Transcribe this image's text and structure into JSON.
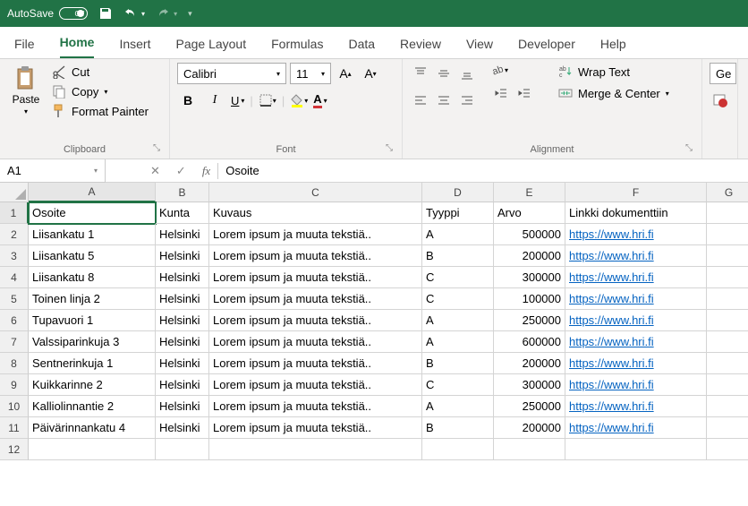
{
  "titlebar": {
    "autosave_label": "AutoSave",
    "autosave_state": "Off"
  },
  "tabs": [
    "File",
    "Home",
    "Insert",
    "Page Layout",
    "Formulas",
    "Data",
    "Review",
    "View",
    "Developer",
    "Help"
  ],
  "active_tab": "Home",
  "clipboard": {
    "paste": "Paste",
    "cut": "Cut",
    "copy": "Copy",
    "format_painter": "Format Painter",
    "label": "Clipboard"
  },
  "font": {
    "name": "Calibri",
    "size": "11",
    "label": "Font"
  },
  "alignment": {
    "wrap": "Wrap Text",
    "merge": "Merge & Center",
    "label": "Alignment"
  },
  "number": {
    "general": "Ge",
    "label": ""
  },
  "namebox": "A1",
  "formula": "Osoite",
  "cols": [
    "A",
    "B",
    "C",
    "D",
    "E",
    "F",
    "G"
  ],
  "headers": [
    "Osoite",
    "Kunta",
    "Kuvaus",
    "Tyyppi",
    "Arvo",
    "Linkki dokumenttiin",
    ""
  ],
  "rows": [
    {
      "a": "Liisankatu 1",
      "b": "Helsinki",
      "c": "Lorem ipsum ja muuta tekstiä..",
      "d": "A",
      "e": "500000",
      "f": "https://www.hri.fi"
    },
    {
      "a": "Liisankatu 5",
      "b": "Helsinki",
      "c": "Lorem ipsum ja muuta tekstiä..",
      "d": "B",
      "e": "200000",
      "f": "https://www.hri.fi"
    },
    {
      "a": "Liisankatu 8",
      "b": "Helsinki",
      "c": "Lorem ipsum ja muuta tekstiä..",
      "d": "C",
      "e": "300000",
      "f": "https://www.hri.fi"
    },
    {
      "a": "Toinen linja 2",
      "b": "Helsinki",
      "c": "Lorem ipsum ja muuta tekstiä..",
      "d": "C",
      "e": "100000",
      "f": "https://www.hri.fi"
    },
    {
      "a": "Tupavuori 1",
      "b": "Helsinki",
      "c": "Lorem ipsum ja muuta tekstiä..",
      "d": "A",
      "e": "250000",
      "f": "https://www.hri.fi"
    },
    {
      "a": "Valssiparinkuja 3",
      "b": "Helsinki",
      "c": "Lorem ipsum ja muuta tekstiä..",
      "d": "A",
      "e": "600000",
      "f": "https://www.hri.fi"
    },
    {
      "a": "Sentnerinkuja 1",
      "b": "Helsinki",
      "c": "Lorem ipsum ja muuta tekstiä..",
      "d": "B",
      "e": "200000",
      "f": "https://www.hri.fi"
    },
    {
      "a": "Kuikkarinne 2",
      "b": "Helsinki",
      "c": "Lorem ipsum ja muuta tekstiä..",
      "d": "C",
      "e": "300000",
      "f": "https://www.hri.fi"
    },
    {
      "a": "Kalliolinnantie 2",
      "b": "Helsinki",
      "c": "Lorem ipsum ja muuta tekstiä..",
      "d": "A",
      "e": "250000",
      "f": "https://www.hri.fi"
    },
    {
      "a": "Päivärinnankatu 4",
      "b": "Helsinki",
      "c": "Lorem ipsum ja muuta tekstiä..",
      "d": "B",
      "e": "200000",
      "f": "https://www.hri.fi"
    }
  ]
}
